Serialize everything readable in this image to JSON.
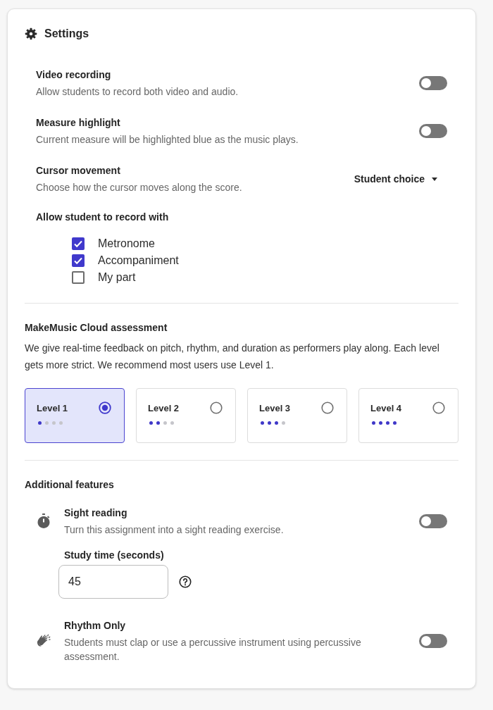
{
  "header": {
    "title": "Settings"
  },
  "settings": [
    {
      "kind": "toggle",
      "label": "Video recording",
      "description": "Allow students to record both video and audio.",
      "on": false
    },
    {
      "kind": "toggle",
      "label": "Measure highlight",
      "description": "Current measure will be highlighted blue as the music plays.",
      "on": false
    },
    {
      "kind": "dropdown",
      "label": "Cursor movement",
      "description": "Choose how the cursor moves along the score.",
      "value": "Student choice"
    }
  ],
  "record_with": {
    "label": "Allow student to record with",
    "options": [
      {
        "label": "Metronome",
        "checked": true
      },
      {
        "label": "Accompaniment",
        "checked": true
      },
      {
        "label": "My part",
        "checked": false
      }
    ]
  },
  "assessment": {
    "title": "MakeMusic Cloud assessment",
    "description": "We give real-time feedback on pitch, rhythm, and duration as performers play along. Each level gets more strict. We recommend most users use Level 1.",
    "levels": [
      {
        "label": "Level 1",
        "selected": true,
        "stars": 1
      },
      {
        "label": "Level 2",
        "selected": false,
        "stars": 2
      },
      {
        "label": "Level 3",
        "selected": false,
        "stars": 3
      },
      {
        "label": "Level 4",
        "selected": false,
        "stars": 4
      }
    ]
  },
  "additional_features": {
    "title": "Additional features",
    "items": [
      {
        "label": "Sight reading",
        "description": "Turn this assignment into a sight reading exercise.",
        "on": false,
        "study_time": {
          "label": "Study time (seconds)",
          "value": "45"
        }
      },
      {
        "label": "Rhythm Only",
        "description": "Students must clap or use a percussive instrument using percussive assessment.",
        "on": false
      }
    ]
  }
}
